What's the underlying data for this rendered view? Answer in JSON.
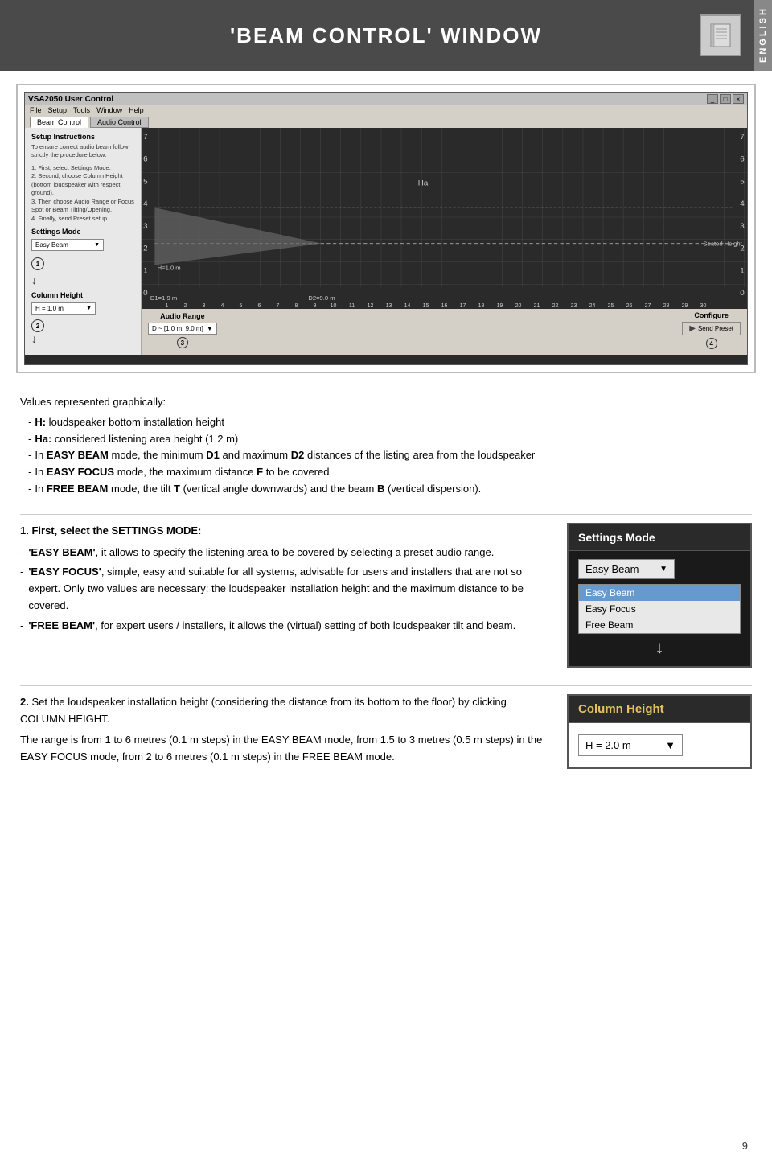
{
  "header": {
    "title": "'BEAM CONTROL' WINDOW",
    "english_label": "ENGLISH"
  },
  "screenshot": {
    "titlebar": "VSA2050 User Control",
    "menu_items": [
      "File",
      "Setup",
      "Tools",
      "Window",
      "Help"
    ],
    "tabs": [
      "Beam Control",
      "Audio Control"
    ],
    "left_panel": {
      "setup_title": "Setup Instructions",
      "setup_text": "To ensure correct audio beam follow strictly the procedure below:",
      "steps": [
        "First, select Settings Mode.",
        "Second, choose Column Height (bottom loudspeaker with respect ground).",
        "Then choose Audio Range or Focus Spot or Beam Tilting/Opening.",
        "Finally, send Preset setup"
      ],
      "settings_mode_label": "Settings Mode",
      "dropdown_value": "Easy Beam",
      "circle1": "1",
      "col_height_label": "Column Height",
      "h_value": "H = 1.0 m",
      "circle2": "2"
    },
    "graph": {
      "h_label": "H=1.0 m",
      "ha_label": "Ha",
      "seated_height": "Seated Height",
      "x_labels": [
        "1",
        "2",
        "3",
        "4",
        "5",
        "6",
        "7",
        "8",
        "9",
        "10",
        "11",
        "12",
        "13",
        "14",
        "15",
        "16",
        "17",
        "18",
        "19",
        "20",
        "21",
        "22",
        "23",
        "24",
        "25",
        "26",
        "27",
        "28",
        "29",
        "30"
      ],
      "y_labels": [
        "0",
        "1",
        "2",
        "3",
        "4",
        "5",
        "6",
        "7"
      ],
      "d1_label": "D1=1.9 m",
      "d2_label": "D2=9.0 m"
    },
    "bottom": {
      "audio_range_label": "Audio Range",
      "configure_label": "Configure",
      "preset_value": "D ~ [1.0 m, 9.0 m]",
      "send_preset_label": "Send Preset",
      "circle3": "3",
      "circle4": "4"
    }
  },
  "values_section": {
    "title": "Values represented graphically:",
    "bullets": [
      {
        "dash": "-",
        "text": "H: loudspeaker bottom installation height"
      },
      {
        "dash": "-",
        "text": "Ha: considered listening area height (1.2 m)"
      },
      {
        "dash": "-",
        "bold_parts": [
          "EASY BEAM"
        ],
        "text": "In EASY BEAM mode, the minimum D1 and maximum D2 distances of the listing area from the loudspeaker"
      },
      {
        "dash": "-",
        "bold_parts": [
          "EASY FOCUS"
        ],
        "text": "In EASY FOCUS mode, the maximum distance F to be covered"
      },
      {
        "dash": "-",
        "bold_parts": [
          "FREE BEAM"
        ],
        "text": "In FREE BEAM mode, the tilt T (vertical angle downwards) and the beam B (vertical dispersion)."
      }
    ]
  },
  "section1": {
    "heading": "1. First, select the SETTINGS MODE:",
    "bullets": [
      {
        "dash": "-",
        "label": "'EASY BEAM'",
        "text": ", it allows to specify the listening area to be covered by selecting a preset audio range."
      },
      {
        "dash": "-",
        "label": "'EASY FOCUS'",
        "text": ", simple, easy and suitable for all systems, advisable for users and installers that are not so expert. Only two values are necessary: the loudspeaker installation height and the maximum distance to be covered."
      },
      {
        "dash": "-",
        "label": "'FREE BEAM'",
        "text": ", for expert users / installers, it allows the (virtual) setting of both loudspeaker tilt and beam."
      }
    ],
    "panel": {
      "title": "Settings Mode",
      "dropdown_value": "Easy Beam",
      "menu_items": [
        "Easy Beam",
        "Easy Focus",
        "Free Beam"
      ],
      "selected_item": "Easy Beam"
    }
  },
  "section2": {
    "heading": "2. Set the loudspeaker installation height (considering the distance from its bottom to the floor) by clicking COLUMN HEIGHT.",
    "body": "The range is from 1 to 6 metres (0.1 m steps) in the EASY BEAM mode, from 1.5 to 3 metres (0.5 m steps) in the EASY FOCUS mode, from 2 to 6 metres (0.1 m steps) in the FREE BEAM mode.",
    "panel": {
      "title": "Column Height",
      "h_value": "H = 2.0 m"
    }
  },
  "page_number": "9"
}
